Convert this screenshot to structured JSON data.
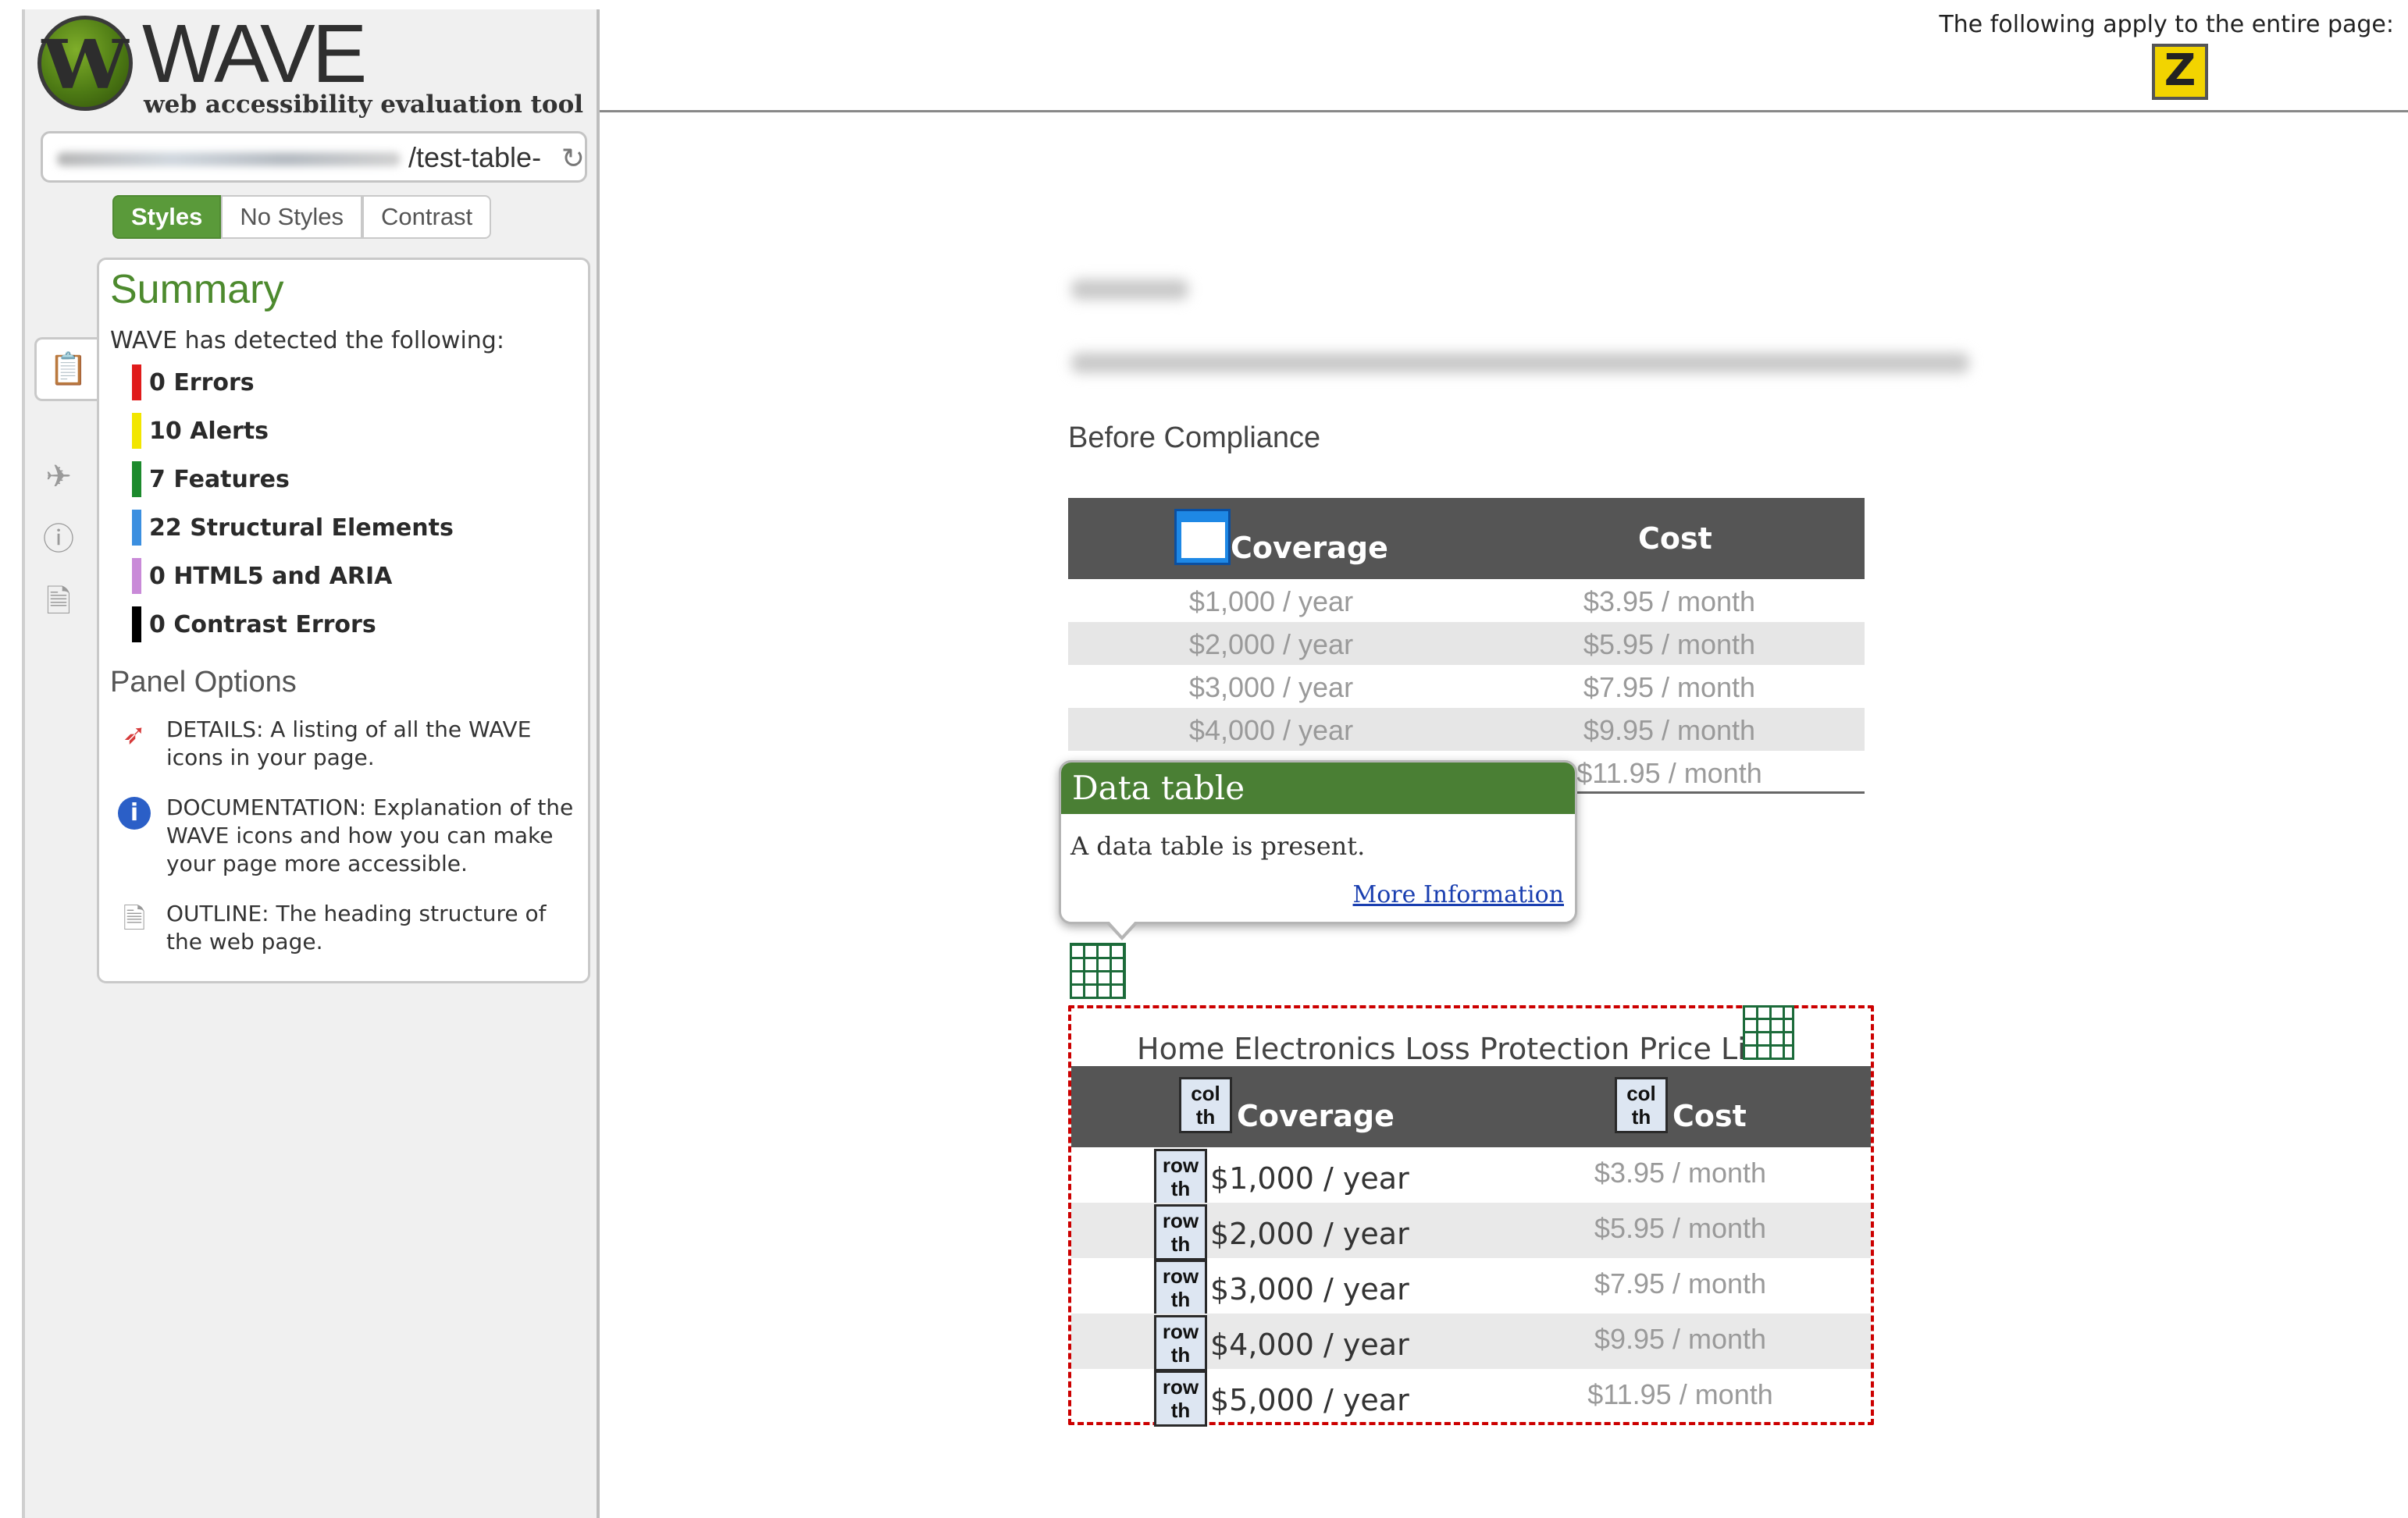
{
  "app": {
    "logo_text": "WAVE",
    "logo_subtitle": "web accessibility evaluation tool",
    "url_visible": "/test-table-"
  },
  "view_tabs": [
    "Styles",
    "No Styles",
    "Contrast"
  ],
  "summary": {
    "title": "Summary",
    "intro": "WAVE has detected the following:",
    "items": [
      {
        "label": "0 Errors",
        "color": "#e01b1b"
      },
      {
        "label": "10 Alerts",
        "color": "#f2e600"
      },
      {
        "label": "7 Features",
        "color": "#1c8a2c"
      },
      {
        "label": "22 Structural Elements",
        "color": "#3b8fe0"
      },
      {
        "label": "0 HTML5 and ARIA",
        "color": "#c98ad8"
      },
      {
        "label": "0 Contrast Errors",
        "color": "#000000"
      }
    ]
  },
  "panel_options": {
    "title": "Panel Options",
    "items": [
      {
        "icon": "details-flag-icon",
        "text": "DETAILS: A listing of all the WAVE icons in your page."
      },
      {
        "icon": "info-icon",
        "text": "DOCUMENTATION: Explanation of the WAVE icons and how you can make your page more accessible."
      },
      {
        "icon": "outline-document-icon",
        "text": "OUTLINE: The heading structure of the web page."
      }
    ]
  },
  "topbar": {
    "note": "The following apply to the entire page:"
  },
  "content": {
    "before_heading": "Before Compliance",
    "table1": {
      "headers": [
        "Coverage",
        "Cost"
      ],
      "rows": [
        [
          "$1,000 / year",
          "$3.95 / month"
        ],
        [
          "$2,000 / year",
          "$5.95 / month"
        ],
        [
          "$3,000 / year",
          "$7.95 / month"
        ],
        [
          "$4,000 / year",
          "$9.95 / month"
        ],
        [
          "",
          "$11.95 / month"
        ]
      ]
    },
    "tooltip": {
      "title": "Data table",
      "body": "A data table is present.",
      "link": "More Information"
    },
    "table2": {
      "caption": "Home Electronics Loss Protection Price List",
      "headers": [
        "Coverage",
        "Cost"
      ],
      "rows": [
        [
          "$1,000 / year",
          "$3.95 / month"
        ],
        [
          "$2,000 / year",
          "$5.95 / month"
        ],
        [
          "$3,000 / year",
          "$7.95 / month"
        ],
        [
          "$4,000 / year",
          "$9.95 / month"
        ],
        [
          "$5,000 / year",
          "$11.95 / month"
        ]
      ],
      "col_badge": [
        "col",
        "th"
      ],
      "row_badge": [
        "row",
        "th"
      ]
    }
  }
}
